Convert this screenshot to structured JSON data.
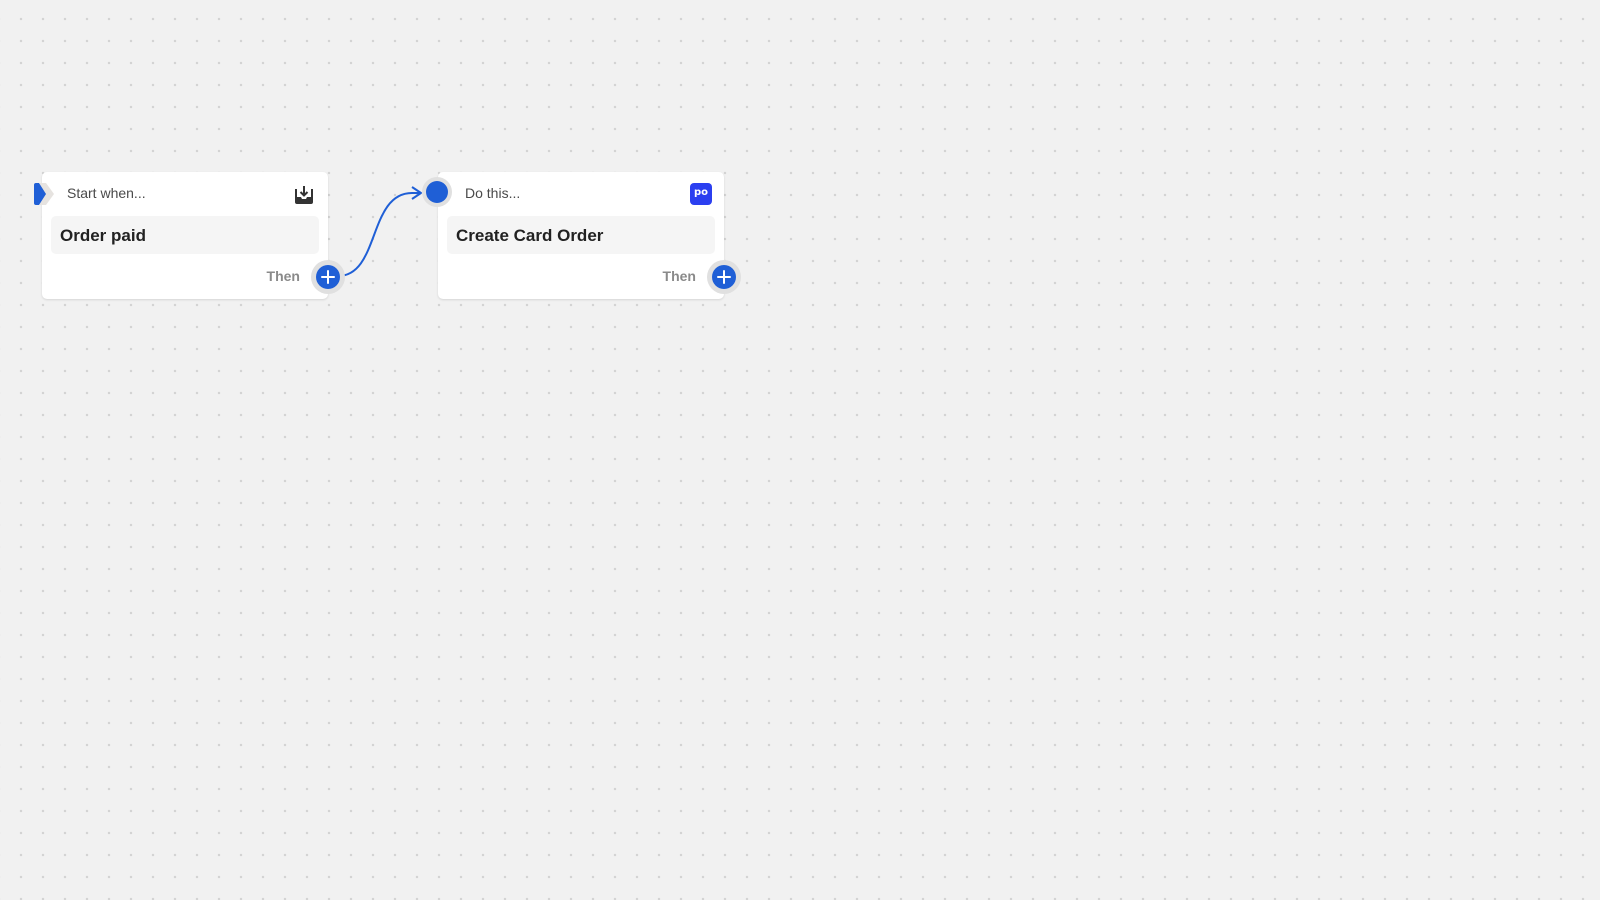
{
  "canvas": {
    "background": "#f1f1f1",
    "accent": "#1f5fd6"
  },
  "nodes": [
    {
      "type": "trigger",
      "header_label": "Start when...",
      "title": "Order paid",
      "then_label": "Then",
      "icon": "download-tray-icon"
    },
    {
      "type": "action",
      "header_label": "Do this...",
      "title": "Create Card Order",
      "then_label": "Then",
      "icon": "app-po-icon",
      "icon_text": "po",
      "icon_color": "#2b3ff0"
    }
  ],
  "connections": [
    {
      "from": "Order paid",
      "to": "Create Card Order"
    }
  ]
}
